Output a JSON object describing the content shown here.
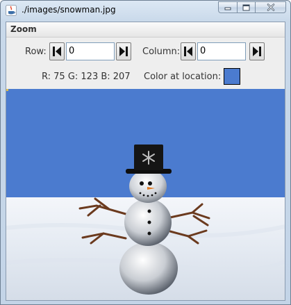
{
  "window": {
    "title": "./images/snowman.jpg",
    "buttons": {
      "minimize_icon": "minimize-icon",
      "maximize_icon": "maximize-icon",
      "close_icon": "close-icon"
    }
  },
  "menu": {
    "items": [
      {
        "label": "Zoom"
      }
    ]
  },
  "controls": {
    "row_label": "Row:",
    "row_value": "0",
    "column_label": "Column:",
    "column_value": "0",
    "rgb_text": "R: 75 G: 123 B: 207",
    "color_label": "Color at location:",
    "color_swatch": "#4b7bcf"
  },
  "picture": {
    "sky_color": "#4b7bcf",
    "snow_color": "#eef2f7"
  }
}
